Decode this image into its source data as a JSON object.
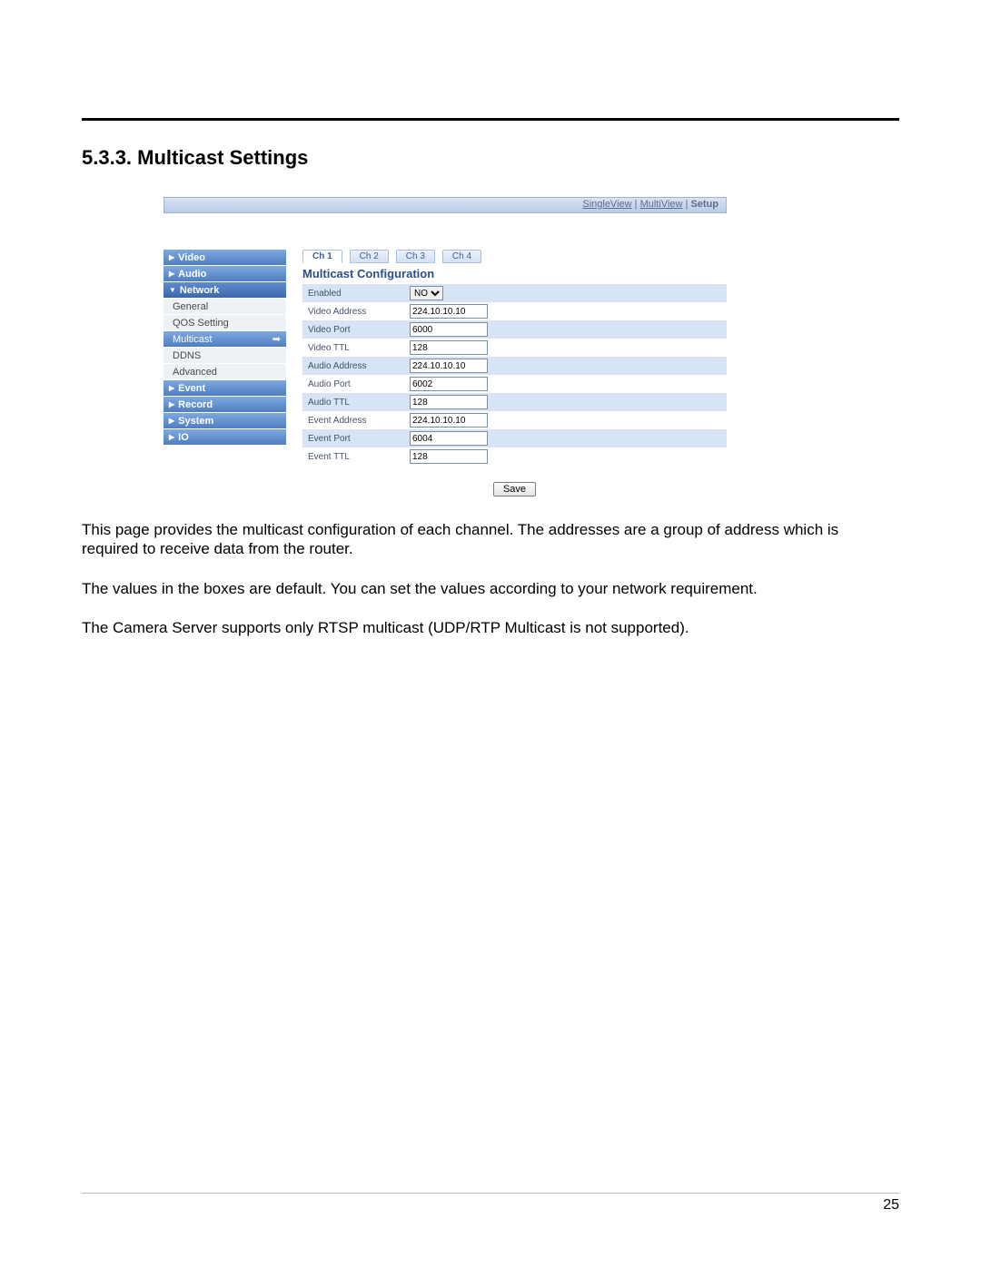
{
  "section_title": "5.3.3. Multicast Settings",
  "topnav": {
    "single": "SingleView",
    "multi": "MultiView",
    "setup": "Setup"
  },
  "sidebar": {
    "video": "Video",
    "audio": "Audio",
    "network": "Network",
    "general": "General",
    "qos": "QOS Setting",
    "multicast": "Multicast",
    "ddns": "DDNS",
    "advanced": "Advanced",
    "event": "Event",
    "record": "Record",
    "system": "System",
    "io": "IO"
  },
  "tabs": {
    "ch1": "Ch 1",
    "ch2": "Ch 2",
    "ch3": "Ch 3",
    "ch4": "Ch 4"
  },
  "panel_title": "Multicast Configuration",
  "form": {
    "enabled_label": "Enabled",
    "enabled_value": "NO",
    "video_address_label": "Video Address",
    "video_address_value": "224.10.10.10",
    "video_port_label": "Video Port",
    "video_port_value": "6000",
    "video_ttl_label": "Video TTL",
    "video_ttl_value": "128",
    "audio_address_label": "Audio Address",
    "audio_address_value": "224.10.10.10",
    "audio_port_label": "Audio Port",
    "audio_port_value": "6002",
    "audio_ttl_label": "Audio TTL",
    "audio_ttl_value": "128",
    "event_address_label": "Event Address",
    "event_address_value": "224.10.10.10",
    "event_port_label": "Event Port",
    "event_port_value": "6004",
    "event_ttl_label": "Event TTL",
    "event_ttl_value": "128"
  },
  "save_button": "Save",
  "paragraphs": {
    "p1": "This page provides the multicast configuration of each channel.  The addresses are a group of address which is required to receive data from the router.",
    "p2": "The values in the boxes are default.  You can set the values according to your network requirement.",
    "p3": "The Camera Server supports only RTSP multicast (UDP/RTP Multicast is not supported)."
  },
  "page_number": "25"
}
